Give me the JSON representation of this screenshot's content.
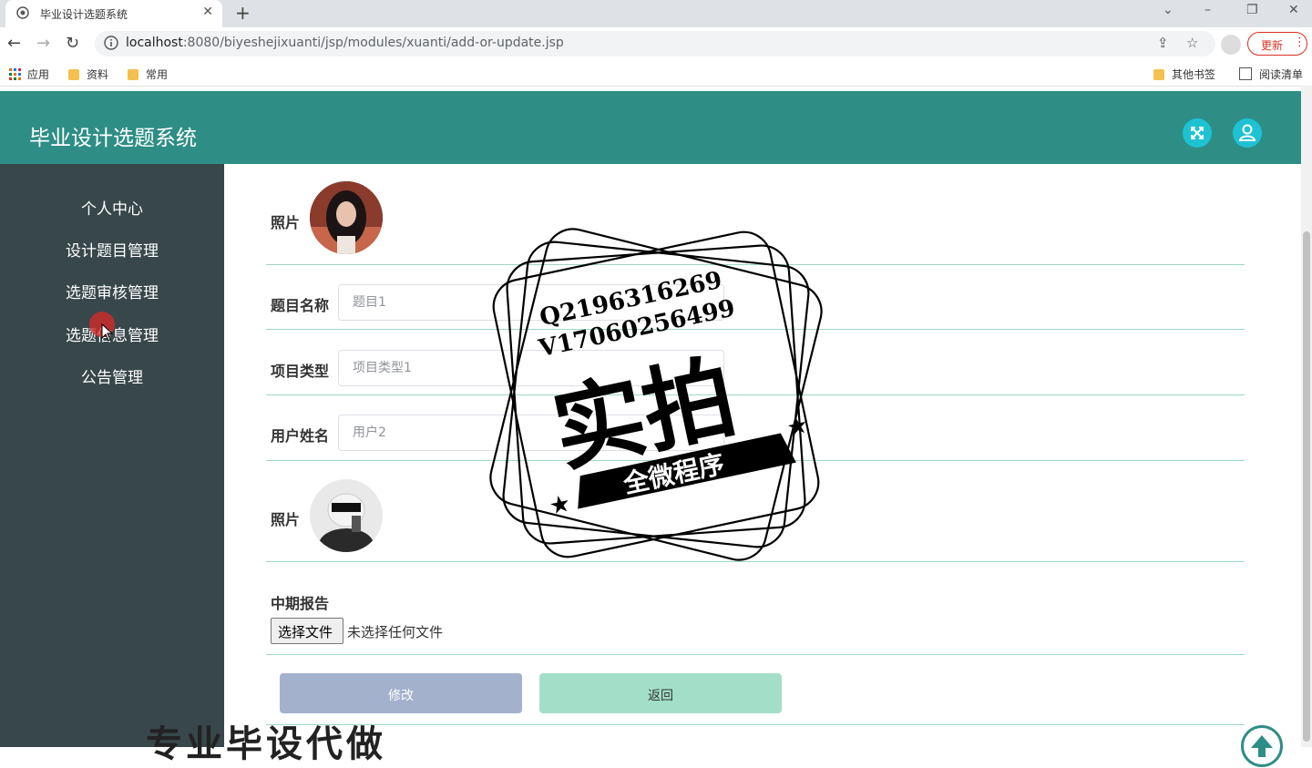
{
  "browser": {
    "tab_title": "毕业设计选题系统",
    "url_host": "localhost",
    "url_rest": ":8080/biyeshejixuanti/jsp/modules/xuanti/add-or-update.jsp",
    "update_label": "更新",
    "bookmarks": [
      "应用",
      "资料",
      "常用"
    ],
    "bookmarks_right": [
      "其他书签",
      "阅读清单"
    ]
  },
  "header": {
    "title": "毕业设计选题系统",
    "icons": [
      "fullscreen-icon",
      "user-icon"
    ],
    "color": "#2e8e86"
  },
  "sidebar": {
    "items": [
      {
        "label": "个人中心"
      },
      {
        "label": "设计题目管理"
      },
      {
        "label": "选题审核管理"
      },
      {
        "label": "选题信息管理"
      },
      {
        "label": "公告管理"
      }
    ]
  },
  "form": {
    "photo1_label": "照片",
    "title_label": "题目名称",
    "title_value": "题目1",
    "type_label": "项目类型",
    "type_value": "项目类型1",
    "user_label": "用户姓名",
    "user_value": "用户2",
    "photo2_label": "照片",
    "report_label": "中期报告",
    "file_button": "选择文件",
    "file_status": "未选择任何文件",
    "submit_label": "修改",
    "back_label": "返回",
    "submit_color": "#a3b1cd",
    "back_color": "#a3dfc8"
  },
  "watermark": {
    "line1": "Q2196316269",
    "line2": "V17060256499",
    "main": "实拍",
    "banner": "全微程序",
    "bottom": "专业毕设代做"
  }
}
